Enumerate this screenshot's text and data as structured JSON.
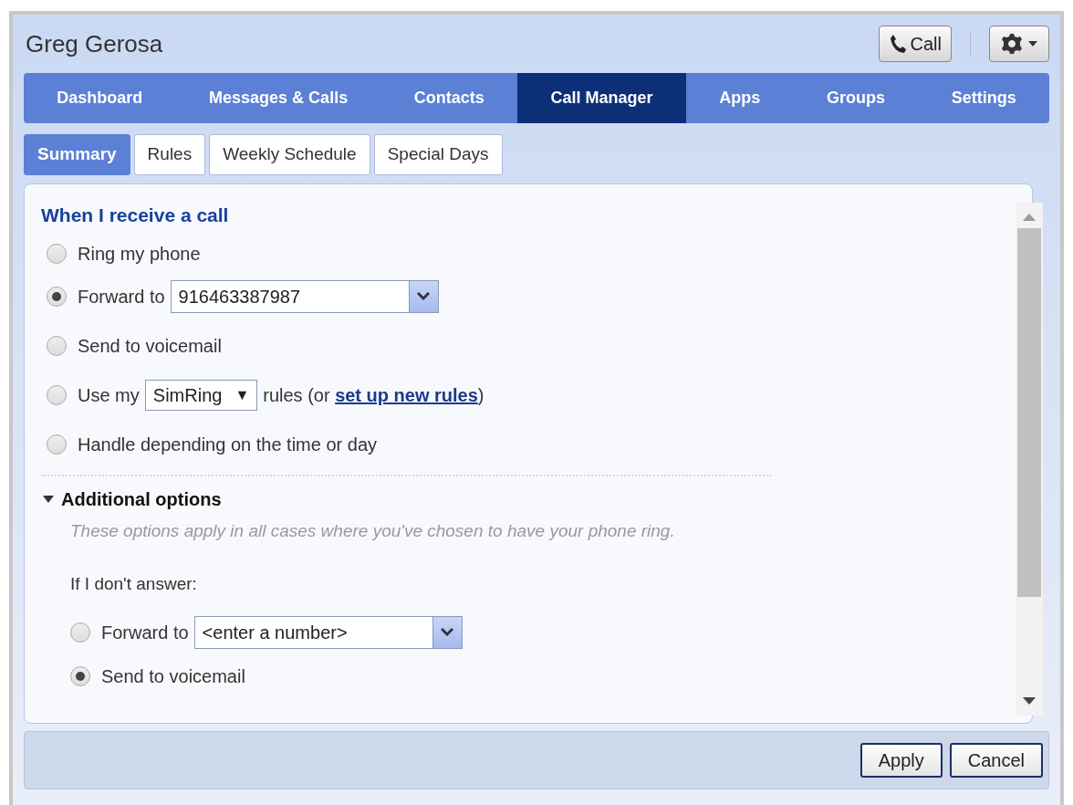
{
  "header": {
    "user_name": "Greg Gerosa",
    "call_button": "Call"
  },
  "nav_tabs": [
    {
      "label": "Dashboard",
      "selected": false
    },
    {
      "label": "Messages & Calls",
      "selected": false
    },
    {
      "label": "Contacts",
      "selected": false
    },
    {
      "label": "Call Manager",
      "selected": true
    },
    {
      "label": "Apps",
      "selected": false
    },
    {
      "label": "Groups",
      "selected": false
    },
    {
      "label": "Settings",
      "selected": false
    }
  ],
  "sub_tabs": [
    {
      "label": "Summary",
      "selected": true
    },
    {
      "label": "Rules",
      "selected": false
    },
    {
      "label": "Weekly Schedule",
      "selected": false
    },
    {
      "label": "Special Days",
      "selected": false
    }
  ],
  "receive_call": {
    "heading": "When I receive a call",
    "options": [
      {
        "kind": "plain",
        "label": "Ring my phone",
        "selected": false
      },
      {
        "kind": "combo",
        "label": "Forward to",
        "value": "916463387987",
        "selected": true
      },
      {
        "kind": "plain",
        "label": "Send to voicemail",
        "selected": false
      },
      {
        "kind": "rules",
        "label": "Use my",
        "select": "SimRing",
        "select_arrow": "▼",
        "after": "rules (or ",
        "link": "set up new rules",
        "end": ")",
        "selected": false
      },
      {
        "kind": "plain",
        "label": "Handle depending on the time or day",
        "selected": false
      }
    ]
  },
  "additional_options": {
    "title": "Additional options",
    "expanded": true,
    "note": "These options apply in all cases where you've chosen to have your phone ring.",
    "prompt": "If I don't answer:",
    "options": [
      {
        "kind": "combo",
        "label": "Forward to",
        "value": "<enter a number>",
        "selected": false
      },
      {
        "kind": "plain",
        "label": "Send to voicemail",
        "selected": true
      }
    ]
  },
  "footer_buttons": [
    "Apply",
    "Cancel"
  ]
}
